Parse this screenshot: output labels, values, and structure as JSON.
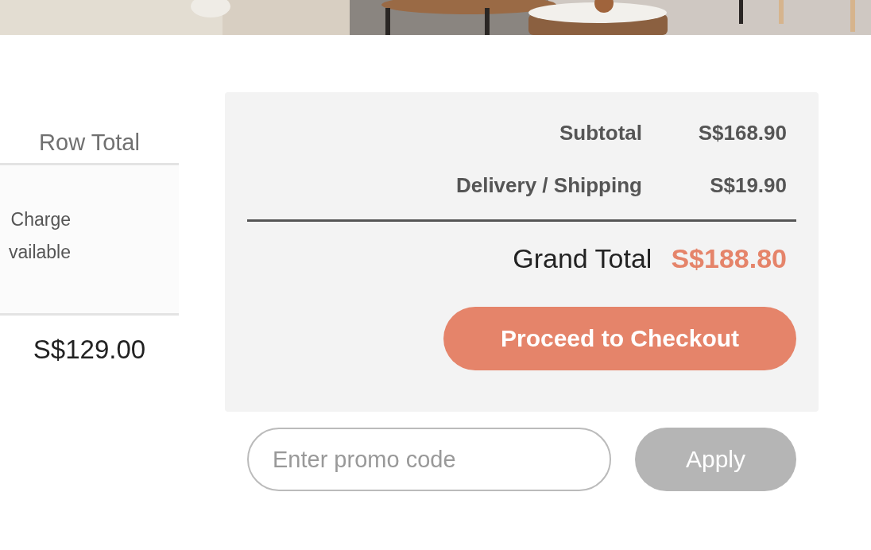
{
  "cart_table": {
    "column_header": "Row Total",
    "note_lines": [
      "Charge",
      "vailable"
    ],
    "row_total": "S$129.00"
  },
  "summary": {
    "rows": [
      {
        "label": "Subtotal",
        "value": "S$168.90"
      },
      {
        "label": "Delivery / Shipping",
        "value": "S$19.90"
      }
    ],
    "grand_total": {
      "label": "Grand Total",
      "value": "S$188.80"
    },
    "checkout_button": "Proceed to Checkout"
  },
  "promo": {
    "placeholder": "Enter promo code",
    "button": "Apply",
    "button_disabled": true
  }
}
